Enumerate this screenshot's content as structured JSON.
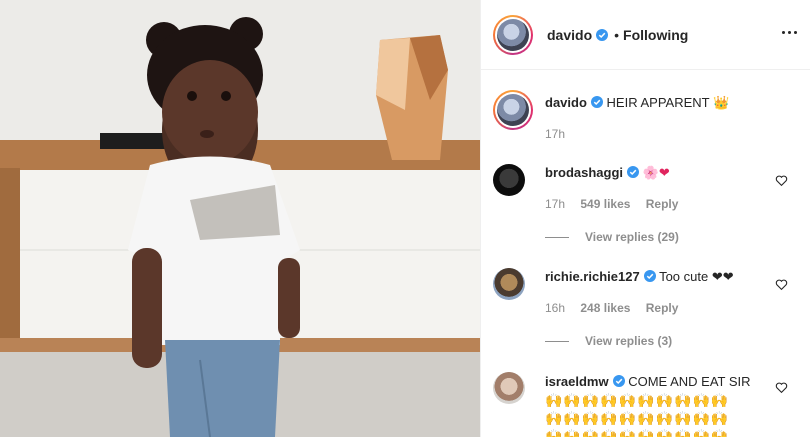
{
  "post": {
    "username": "davido",
    "separator": "•",
    "follow_status": "Following"
  },
  "caption": {
    "username": "davido",
    "text": "HEIR APPARENT",
    "emoji": "👑",
    "time": "17h"
  },
  "comments": [
    {
      "username": "brodashaggi",
      "text": "🌸❤",
      "time": "17h",
      "likes": "549 likes",
      "reply_label": "Reply",
      "view_replies": "View replies (29)"
    },
    {
      "username": "richie.richie127",
      "text": "Too cute ❤❤",
      "time": "16h",
      "likes": "248 likes",
      "reply_label": "Reply",
      "view_replies": "View replies (3)"
    },
    {
      "username": "israeldmw",
      "text": "COME AND EAT SIR",
      "emoji_line_1": "🙌🙌🙌🙌🙌🙌🙌🙌🙌🙌",
      "emoji_line_2": "🙌🙌🙌🙌🙌🙌🙌🙌🙌🙌",
      "emoji_line_3": "🙌🙌🙌🙌🙌🙌🙌🙌🙌🙌"
    }
  ],
  "icons": {
    "verified": "verified-badge-icon",
    "heart": "heart-outline-icon",
    "more": "more-options-icon"
  },
  "colors": {
    "verified_blue": "#3897f0",
    "text": "#262626",
    "muted": "#8e8e8e",
    "heart_red": "#e0245e"
  }
}
